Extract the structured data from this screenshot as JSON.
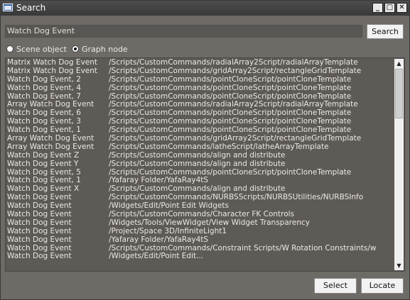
{
  "window": {
    "title": "Search"
  },
  "search": {
    "value": "Watch Dog Event",
    "button_label": "Search"
  },
  "scope": {
    "options": [
      {
        "label": "Scene object",
        "selected": false
      },
      {
        "label": "Graph node",
        "selected": true
      }
    ]
  },
  "results": [
    {
      "event": "Matrix Watch Dog Event",
      "path": "/Scripts/CustomCommands/radialArray2Script/radialArrayTemplate"
    },
    {
      "event": "Matrix Watch Dog Event",
      "path": "/Scripts/CustomCommands/gridArray2Script/rectangleGridTemplate"
    },
    {
      "event": "Watch Dog Event, 2",
      "path": "/Scripts/CustomCommands/pointCloneScript/pointCloneTemplate"
    },
    {
      "event": "Watch Dog Event, 4",
      "path": "/Scripts/CustomCommands/pointCloneScript/pointCloneTemplate"
    },
    {
      "event": "Watch Dog Event, 7",
      "path": "/Scripts/CustomCommands/pointCloneScript/pointCloneTemplate"
    },
    {
      "event": "Array Watch Dog Event",
      "path": "/Scripts/CustomCommands/radialArray2Script/radialArrayTemplate"
    },
    {
      "event": "Watch Dog Event, 6",
      "path": "/Scripts/CustomCommands/pointCloneScript/pointCloneTemplate"
    },
    {
      "event": "Watch Dog Event, 3",
      "path": "/Scripts/CustomCommands/pointCloneScript/pointCloneTemplate"
    },
    {
      "event": "Watch Dog Event, 1",
      "path": "/Scripts/CustomCommands/pointCloneScript/pointCloneTemplate"
    },
    {
      "event": "Array Watch Dog Event",
      "path": "/Scripts/CustomCommands/gridArray2Script/rectangleGridTemplate"
    },
    {
      "event": "Array Watch Dog Event",
      "path": "/Scripts/CustomCommands/latheScript/latheArrayTemplate"
    },
    {
      "event": "Watch Dog Event Z",
      "path": "/Scripts/CustomCommands/align and distribute"
    },
    {
      "event": "Watch Dog Event Y",
      "path": "/Scripts/CustomCommands/align and distribute"
    },
    {
      "event": "Watch Dog Event, 5",
      "path": "/Scripts/CustomCommands/pointCloneScript/pointCloneTemplate"
    },
    {
      "event": "Watch Dog Event, 1",
      "path": "/Yafaray Folder/YafaRay4tS"
    },
    {
      "event": "Watch Dog Event X",
      "path": "/Scripts/CustomCommands/align and distribute"
    },
    {
      "event": "Watch Dog Event",
      "path": "/Scripts/CustomCommands/NURBSScripts/NURBSUtilities/NURBSInfo"
    },
    {
      "event": "Watch Dog Event",
      "path": "/Widgets/Edit/Point Edit Widgets"
    },
    {
      "event": "Watch Dog Event",
      "path": "/Scripts/CustomCommands/Character FK Controls"
    },
    {
      "event": "Watch Dog Event",
      "path": "/Widgets/Tools/ViewWidget/View Widget Transparency"
    },
    {
      "event": "Watch Dog Event",
      "path": "/Project/Space 3D/InfiniteLight1"
    },
    {
      "event": "Watch Dog Event",
      "path": "/Yafaray Folder/YafaRay4tS"
    },
    {
      "event": "Watch Dog Event",
      "path": "/Scripts/CustomCommands/Constraint Scripts/W Rotation Constraints/w"
    },
    {
      "event": "Watch Dog Event",
      "path": "/Widgets/Edit/Point Edit..."
    }
  ],
  "buttons": {
    "select": "Select",
    "locate": "Locate"
  }
}
